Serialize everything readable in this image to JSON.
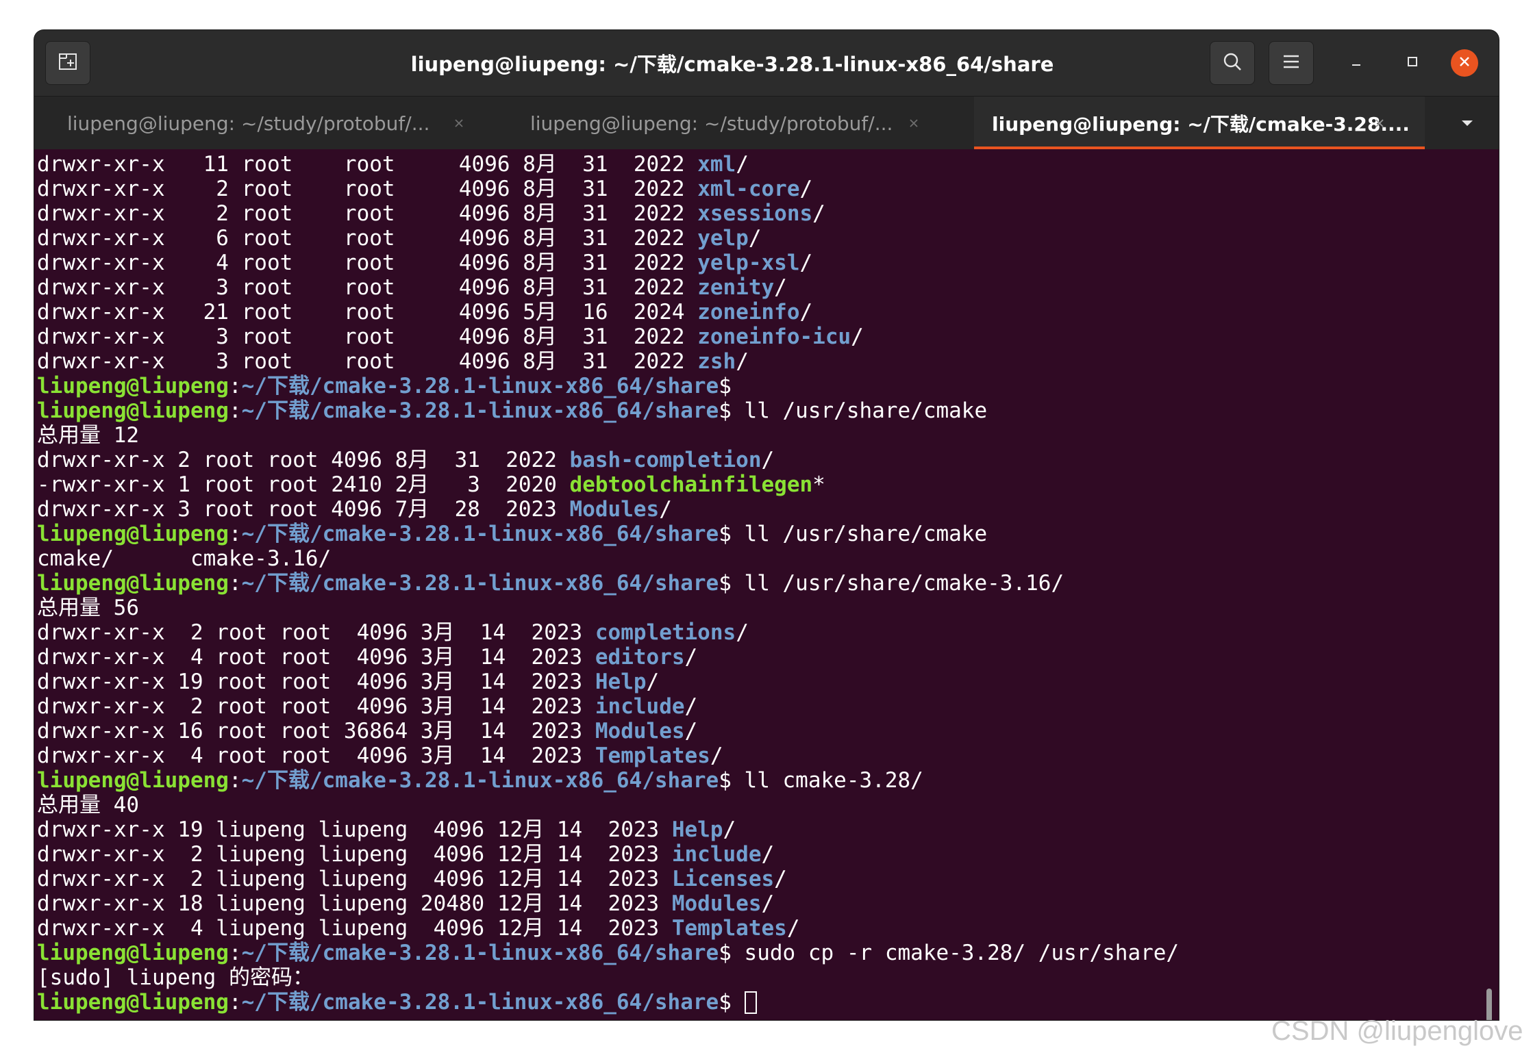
{
  "window": {
    "title": "liupeng@liupeng: ~/下载/cmake-3.28.1-linux-x86_64/share"
  },
  "tabs": [
    {
      "label": "liupeng@liupeng: ~/study/protobuf/...",
      "active": false
    },
    {
      "label": "liupeng@liupeng: ~/study/protobuf/...",
      "active": false
    },
    {
      "label": "liupeng@liupeng: ~/下载/cmake-3.28....",
      "active": true
    }
  ],
  "icons": {
    "new_tab": "new-tab-icon",
    "search": "search-icon",
    "menu": "hamburger-menu-icon",
    "minimize": "minimize-icon",
    "maximize": "maximize-icon",
    "close": "close-icon",
    "tab_close": "tab-close-icon",
    "tabs_dropdown": "chevron-down-icon"
  },
  "colors": {
    "terminal_bg": "#300a24",
    "prompt_user": "#8ae234",
    "prompt_path": "#729fcf",
    "directory": "#729fcf",
    "executable": "#8ae234",
    "accent": "#e95420"
  },
  "terminal": {
    "prompt_user": "liupeng@liupeng",
    "prompt_path": "~/下载/cmake-3.28.1-linux-x86_64/share",
    "lines": [
      [
        {
          "t": "drwxr-xr-x   11 root    root     4096 8月  31  2022 "
        },
        {
          "t": "xml",
          "c": "d"
        },
        {
          "t": "/"
        }
      ],
      [
        {
          "t": "drwxr-xr-x    2 root    root     4096 8月  31  2022 "
        },
        {
          "t": "xml-core",
          "c": "d"
        },
        {
          "t": "/"
        }
      ],
      [
        {
          "t": "drwxr-xr-x    2 root    root     4096 8月  31  2022 "
        },
        {
          "t": "xsessions",
          "c": "d"
        },
        {
          "t": "/"
        }
      ],
      [
        {
          "t": "drwxr-xr-x    6 root    root     4096 8月  31  2022 "
        },
        {
          "t": "yelp",
          "c": "d"
        },
        {
          "t": "/"
        }
      ],
      [
        {
          "t": "drwxr-xr-x    4 root    root     4096 8月  31  2022 "
        },
        {
          "t": "yelp-xsl",
          "c": "d"
        },
        {
          "t": "/"
        }
      ],
      [
        {
          "t": "drwxr-xr-x    3 root    root     4096 8月  31  2022 "
        },
        {
          "t": "zenity",
          "c": "d"
        },
        {
          "t": "/"
        }
      ],
      [
        {
          "t": "drwxr-xr-x   21 root    root     4096 5月  16  2024 "
        },
        {
          "t": "zoneinfo",
          "c": "d"
        },
        {
          "t": "/"
        }
      ],
      [
        {
          "t": "drwxr-xr-x    3 root    root     4096 8月  31  2022 "
        },
        {
          "t": "zoneinfo-icu",
          "c": "d"
        },
        {
          "t": "/"
        }
      ],
      [
        {
          "t": "drwxr-xr-x    3 root    root     4096 8月  31  2022 "
        },
        {
          "t": "zsh",
          "c": "d"
        },
        {
          "t": "/"
        }
      ],
      [
        {
          "t": "liupeng@liupeng",
          "c": "u"
        },
        {
          "t": ":"
        },
        {
          "t": "~/下载/cmake-3.28.1-linux-x86_64/share",
          "c": "p"
        },
        {
          "t": "$ "
        }
      ],
      [
        {
          "t": "liupeng@liupeng",
          "c": "u"
        },
        {
          "t": ":"
        },
        {
          "t": "~/下载/cmake-3.28.1-linux-x86_64/share",
          "c": "p"
        },
        {
          "t": "$ ll /usr/share/cmake"
        }
      ],
      [
        {
          "t": "总用量 12"
        }
      ],
      [
        {
          "t": "drwxr-xr-x 2 root root 4096 8月  31  2022 "
        },
        {
          "t": "bash-completion",
          "c": "d"
        },
        {
          "t": "/"
        }
      ],
      [
        {
          "t": "-rwxr-xr-x 1 root root 2410 2月   3  2020 "
        },
        {
          "t": "debtoolchainfilegen",
          "c": "x"
        },
        {
          "t": "*"
        }
      ],
      [
        {
          "t": "drwxr-xr-x 3 root root 4096 7月  28  2023 "
        },
        {
          "t": "Modules",
          "c": "d"
        },
        {
          "t": "/"
        }
      ],
      [
        {
          "t": "liupeng@liupeng",
          "c": "u"
        },
        {
          "t": ":"
        },
        {
          "t": "~/下载/cmake-3.28.1-linux-x86_64/share",
          "c": "p"
        },
        {
          "t": "$ ll /usr/share/cmake"
        }
      ],
      [
        {
          "t": "cmake/      cmake-3.16/"
        }
      ],
      [
        {
          "t": "liupeng@liupeng",
          "c": "u"
        },
        {
          "t": ":"
        },
        {
          "t": "~/下载/cmake-3.28.1-linux-x86_64/share",
          "c": "p"
        },
        {
          "t": "$ ll /usr/share/cmake-3.16/"
        }
      ],
      [
        {
          "t": "总用量 56"
        }
      ],
      [
        {
          "t": "drwxr-xr-x  2 root root  4096 3月  14  2023 "
        },
        {
          "t": "completions",
          "c": "d"
        },
        {
          "t": "/"
        }
      ],
      [
        {
          "t": "drwxr-xr-x  4 root root  4096 3月  14  2023 "
        },
        {
          "t": "editors",
          "c": "d"
        },
        {
          "t": "/"
        }
      ],
      [
        {
          "t": "drwxr-xr-x 19 root root  4096 3月  14  2023 "
        },
        {
          "t": "Help",
          "c": "d"
        },
        {
          "t": "/"
        }
      ],
      [
        {
          "t": "drwxr-xr-x  2 root root  4096 3月  14  2023 "
        },
        {
          "t": "include",
          "c": "d"
        },
        {
          "t": "/"
        }
      ],
      [
        {
          "t": "drwxr-xr-x 16 root root 36864 3月  14  2023 "
        },
        {
          "t": "Modules",
          "c": "d"
        },
        {
          "t": "/"
        }
      ],
      [
        {
          "t": "drwxr-xr-x  4 root root  4096 3月  14  2023 "
        },
        {
          "t": "Templates",
          "c": "d"
        },
        {
          "t": "/"
        }
      ],
      [
        {
          "t": "liupeng@liupeng",
          "c": "u"
        },
        {
          "t": ":"
        },
        {
          "t": "~/下载/cmake-3.28.1-linux-x86_64/share",
          "c": "p"
        },
        {
          "t": "$ ll cmake-3.28/"
        }
      ],
      [
        {
          "t": "总用量 40"
        }
      ],
      [
        {
          "t": "drwxr-xr-x 19 liupeng liupeng  4096 12月 14  2023 "
        },
        {
          "t": "Help",
          "c": "d"
        },
        {
          "t": "/"
        }
      ],
      [
        {
          "t": "drwxr-xr-x  2 liupeng liupeng  4096 12月 14  2023 "
        },
        {
          "t": "include",
          "c": "d"
        },
        {
          "t": "/"
        }
      ],
      [
        {
          "t": "drwxr-xr-x  2 liupeng liupeng  4096 12月 14  2023 "
        },
        {
          "t": "Licenses",
          "c": "d"
        },
        {
          "t": "/"
        }
      ],
      [
        {
          "t": "drwxr-xr-x 18 liupeng liupeng 20480 12月 14  2023 "
        },
        {
          "t": "Modules",
          "c": "d"
        },
        {
          "t": "/"
        }
      ],
      [
        {
          "t": "drwxr-xr-x  4 liupeng liupeng  4096 12月 14  2023 "
        },
        {
          "t": "Templates",
          "c": "d"
        },
        {
          "t": "/"
        }
      ],
      [
        {
          "t": "liupeng@liupeng",
          "c": "u"
        },
        {
          "t": ":"
        },
        {
          "t": "~/下载/cmake-3.28.1-linux-x86_64/share",
          "c": "p"
        },
        {
          "t": "$ sudo cp -r cmake-3.28/ /usr/share/"
        }
      ],
      [
        {
          "t": "[sudo] liupeng 的密码："
        }
      ],
      [
        {
          "t": "liupeng@liupeng",
          "c": "u"
        },
        {
          "t": ":"
        },
        {
          "t": "~/下载/cmake-3.28.1-linux-x86_64/share",
          "c": "p"
        },
        {
          "t": "$ "
        },
        {
          "t": "",
          "c": "cursor"
        }
      ]
    ]
  },
  "watermark": "CSDN @liupenglove"
}
